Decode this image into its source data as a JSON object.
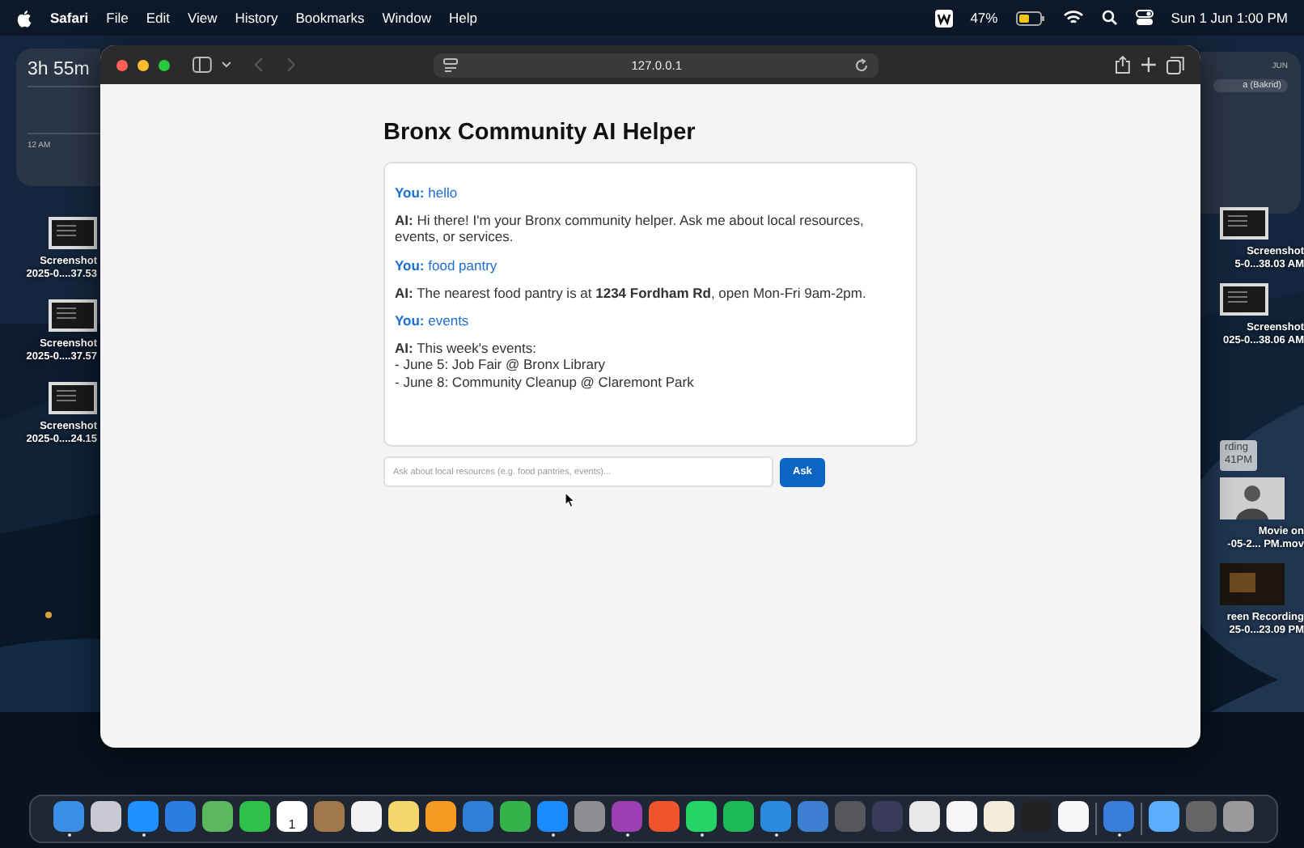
{
  "menu_bar": {
    "app_name": "Safari",
    "menus": [
      "File",
      "Edit",
      "View",
      "History",
      "Bookmarks",
      "Window",
      "Help"
    ],
    "battery_percent": "47%",
    "clock": "Sun 1 Jun  1:00 PM"
  },
  "widgets": {
    "screen_time": {
      "total": "3h 55m",
      "axis_label": "12 AM"
    },
    "calendar": {
      "month": "JUN",
      "event": "a (Bakrid)"
    }
  },
  "desktop_icons_left": [
    {
      "line1": "Screenshot",
      "line2": "2025-0....37.53"
    },
    {
      "line1": "Screenshot",
      "line2": "2025-0....37.57"
    },
    {
      "line1": "Screenshot",
      "line2": "2025-0....24.15"
    }
  ],
  "desktop_icons_right": [
    {
      "kind": "screenshot",
      "line1": "Screenshot",
      "line2": "5-0...38.03 AM"
    },
    {
      "kind": "screenshot",
      "line1": "Screenshot",
      "line2": "025-0...38.06 AM"
    },
    {
      "kind": "movie",
      "line1": "Movie on",
      "line2": "-05-2... PM.mov"
    },
    {
      "kind": "recording",
      "line1": "reen Recording",
      "line2": "25-0...23.09 PM"
    }
  ],
  "covered_label": {
    "line1": "rding",
    "line2": "41PM"
  },
  "browser": {
    "address": "127.0.0.1",
    "back_disabled": true,
    "forward_disabled": true
  },
  "page": {
    "title": "Bronx Community AI Helper",
    "messages": [
      {
        "kind": "user",
        "speaker": "You:",
        "text": "hello"
      },
      {
        "kind": "ai",
        "speaker": "AI:",
        "text": "Hi there! I'm your Bronx community helper. Ask me about local resources, events, or services."
      },
      {
        "kind": "user",
        "speaker": "You:",
        "text": "food pantry"
      },
      {
        "kind": "ai",
        "speaker": "AI:",
        "text": "The nearest food pantry is at **1234 Fordham Rd**, open Mon-Fri 9am-2pm."
      },
      {
        "kind": "user",
        "speaker": "You:",
        "text": "events"
      },
      {
        "kind": "ai",
        "speaker": "AI:",
        "text": "This week's events:\n- June 5: Job Fair @ Bronx Library\n- June 8: Community Cleanup @ Claremont Park"
      }
    ],
    "input": {
      "placeholder": "Ask about local resources (e.g. food pantries, events)..."
    },
    "button": "Ask"
  },
  "dock": {
    "apps": [
      {
        "color": "#3a8ee6",
        "running": true
      },
      {
        "color": "#c9c9d2",
        "running": false
      },
      {
        "color": "#1e90ff",
        "running": true
      },
      {
        "color": "#2a7de1",
        "running": false
      },
      {
        "color": "#5cb85c",
        "running": false
      },
      {
        "color": "#2fc24a",
        "running": false
      },
      {
        "color": "#ffffff",
        "running": false,
        "text": "1"
      },
      {
        "color": "#a0784a",
        "running": false
      },
      {
        "color": "#f2f2f2",
        "running": false
      },
      {
        "color": "#f5d76e",
        "running": false
      },
      {
        "color": "#f59a23",
        "running": false
      },
      {
        "color": "#2d7fd8",
        "running": false
      },
      {
        "color": "#36b24a",
        "running": false
      },
      {
        "color": "#1a8cff",
        "running": true
      },
      {
        "color": "#8e8e93",
        "running": false
      },
      {
        "color": "#9b3fb5",
        "running": true
      },
      {
        "color": "#f0542d",
        "running": false
      },
      {
        "color": "#25d366",
        "running": true
      },
      {
        "color": "#1db954",
        "running": false
      },
      {
        "color": "#2a8ae0",
        "running": true
      },
      {
        "color": "#3d7fd1",
        "running": false
      },
      {
        "color": "#55575c",
        "running": false
      },
      {
        "color": "#3a3a5a",
        "running": false
      },
      {
        "color": "#e8e8e8",
        "running": false
      },
      {
        "color": "#f7f7f7",
        "running": false
      },
      {
        "color": "#f4ecd8",
        "running": false
      },
      {
        "color": "#222222",
        "running": false
      },
      {
        "color": "#f7f7f7",
        "running": false
      }
    ],
    "recent": [
      {
        "color": "#3b7ddb",
        "running": true
      }
    ],
    "stacks": [
      {
        "color": "#5aaefc",
        "running": false
      },
      {
        "color": "#666666",
        "running": false
      },
      {
        "color": "#9a9a9a",
        "running": false
      }
    ]
  }
}
